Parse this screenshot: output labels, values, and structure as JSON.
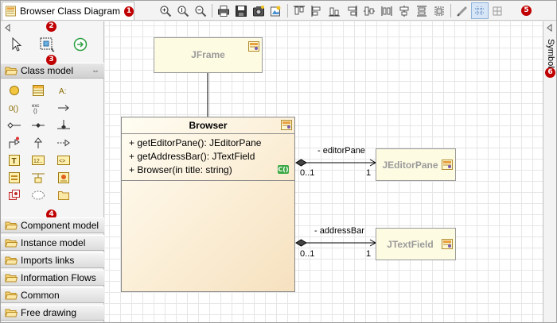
{
  "tab": {
    "title": "Browser Class Diagram",
    "badge": "1"
  },
  "badges": {
    "palette_tools": "2",
    "class_model": "3",
    "sections": "4",
    "toolbar": "5",
    "symbol": "6"
  },
  "toolbar": {
    "buttons": [
      "zoom-in-icon",
      "zoom-reset-icon",
      "zoom-out-icon",
      "print-icon",
      "save-icon",
      "snapshot-icon",
      "export-icon",
      "align-top-icon",
      "align-left-icon",
      "align-bottom-icon",
      "align-right-icon",
      "align-vcenter-icon",
      "distribute-v-icon",
      "align-hcenter-icon",
      "distribute-h-icon",
      "same-size-icon",
      "pen-icon",
      "grid-icon",
      "snap-icon"
    ]
  },
  "palette": {
    "sections": {
      "class_model": "Class model",
      "component_model": "Component model",
      "instance_model": "Instance model",
      "imports_links": "Imports links",
      "information_flows": "Information Flows",
      "common": "Common",
      "free_drawing": "Free drawing"
    }
  },
  "symbol_panel": {
    "label": "Symbol"
  },
  "diagram": {
    "jframe": {
      "name": "JFrame"
    },
    "browser": {
      "name": "Browser",
      "operations": [
        "+ getEditorPane(): JEditorPane",
        "+ getAddressBar(): JTextField",
        "+ Browser(in title: string)"
      ],
      "ctor_badge": "C()"
    },
    "jeditorpane": {
      "name": "JEditorPane"
    },
    "jtextfield": {
      "name": "JTextField"
    },
    "links": {
      "editor": {
        "role": "- editorPane",
        "source_mult": "0..1",
        "target_mult": "1"
      },
      "address": {
        "role": "- addressBar",
        "source_mult": "0..1",
        "target_mult": "1"
      }
    }
  },
  "colors": {
    "badge": "#c00000",
    "class_fill": "#fefbe3",
    "browser_fill_end": "#f6e1bf",
    "ctor_badge": "#39a842",
    "grid": "#e6e6e6"
  }
}
